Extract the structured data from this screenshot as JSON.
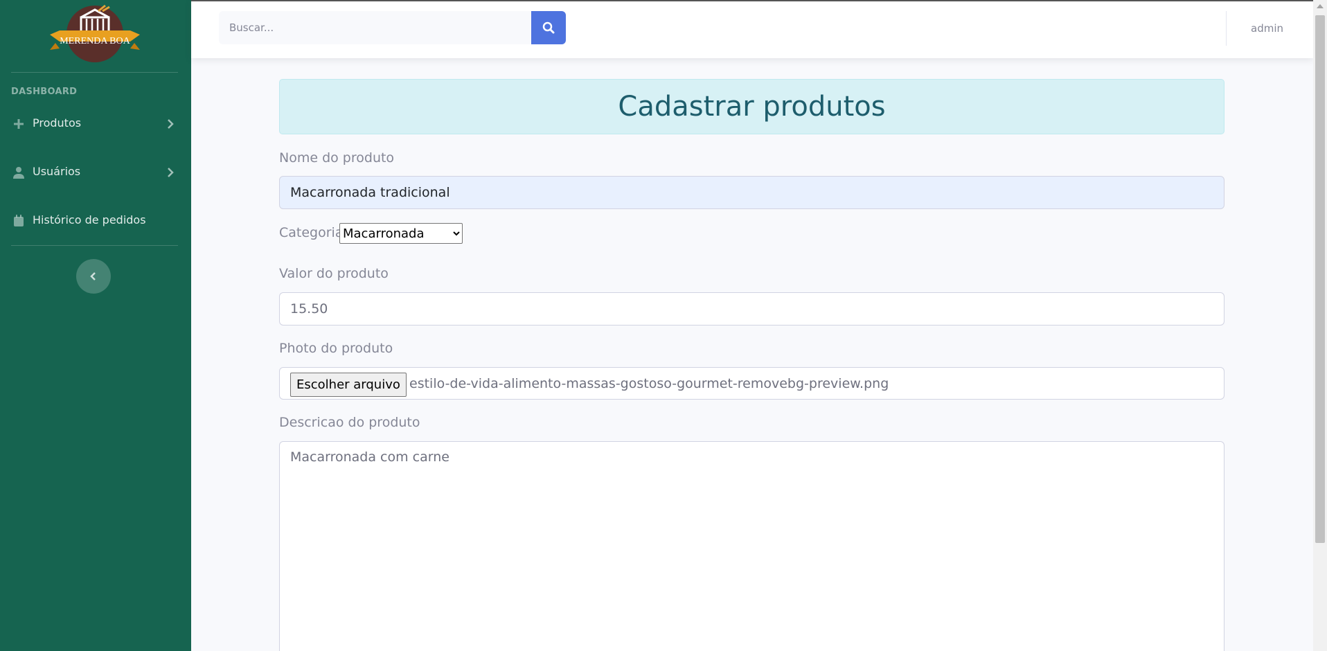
{
  "sidebar": {
    "logo_text": "MERENDA BOA",
    "heading": "DASHBOARD",
    "items": [
      {
        "label": "Produtos",
        "icon": "plus-icon",
        "has_chevron": true
      },
      {
        "label": "Usuários",
        "icon": "user-icon",
        "has_chevron": true
      },
      {
        "label": "Histórico de pedidos",
        "icon": "calendar-icon",
        "has_chevron": false
      }
    ],
    "toggle_icon": "chevron-left-icon",
    "background_color": "#166450"
  },
  "topbar": {
    "search_placeholder": "Buscar...",
    "search_icon": "search-icon",
    "search_button_color": "#4e73df",
    "user_name": "admin"
  },
  "form": {
    "title": "Cadastrar produtos",
    "name_label": "Nome do produto",
    "name_value": "Macarronada tradicional",
    "category_label": "Categoria",
    "category_selected": "Macarronada",
    "price_label": "Valor do produto",
    "price_value": "15.50",
    "photo_label": "Photo do produto",
    "photo_button": "Escolher arquivo",
    "photo_filename": "estilo-de-vida-alimento-massas-gostoso-gourmet-removebg-preview.png",
    "description_label": "Descricao do produto",
    "description_value": "Macarronada com carne"
  }
}
